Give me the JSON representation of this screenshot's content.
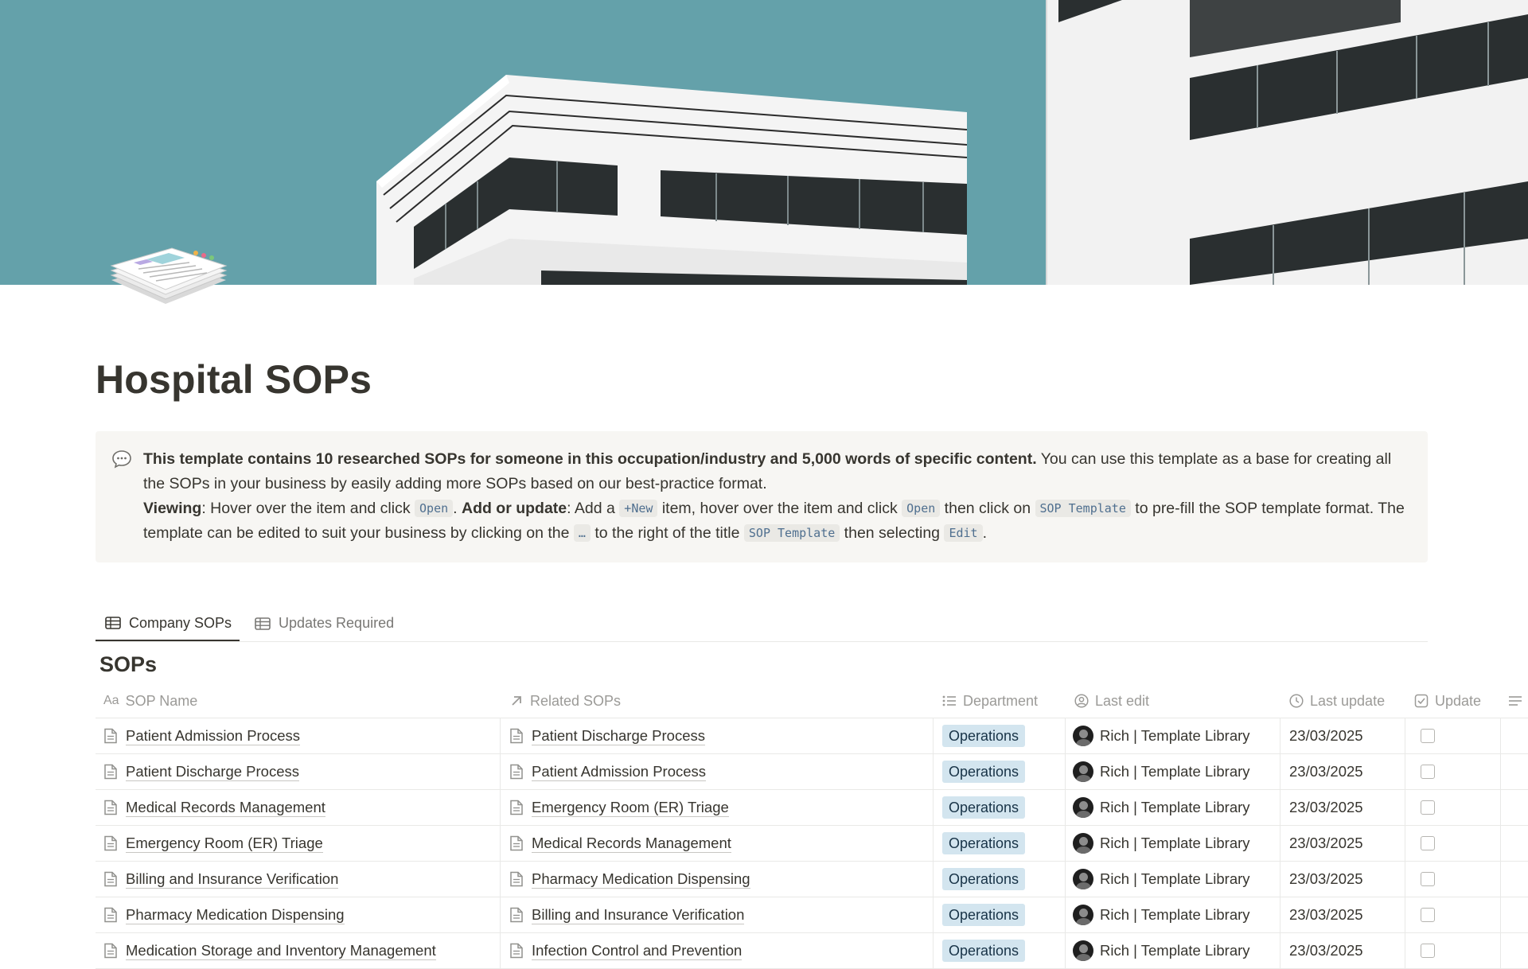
{
  "page": {
    "title": "Hospital SOPs",
    "icon": "stacked-papers-icon"
  },
  "callout": {
    "icon": "speech-bubble-icon",
    "bold_intro": "This template contains 10 researched SOPs for someone in this occupation/industry and 5,000 words of specific content.",
    "intro_rest": " You can use this template as a base for creating all the SOPs in your business by easily adding more SOPs based on our best-practice format.",
    "viewing_label": "Viewing",
    "viewing_text_1": ": Hover over the item and click ",
    "code_open": "Open",
    "viewing_text_2": ". ",
    "add_label": "Add or update",
    "add_text_1": ": Add a ",
    "code_new": "+New",
    "add_text_2": " item, hover over the item and click ",
    "code_open_2": "Open",
    "add_text_3": " then click on ",
    "code_sop_template": "SOP Template",
    "add_text_4": " to pre-fill the SOP template format. The template can be edited to suit your business by clicking on the ",
    "code_dots": "…",
    "add_text_5": " to the right of the title ",
    "code_sop_template_2": "SOP Template",
    "add_text_6": " then selecting ",
    "code_edit": "Edit",
    "add_text_7": "."
  },
  "tabs": [
    {
      "label": "Company SOPs",
      "icon": "table-icon",
      "active": true
    },
    {
      "label": "Updates Required",
      "icon": "table-icon",
      "active": false
    }
  ],
  "database": {
    "title": "SOPs",
    "columns": [
      {
        "label": "SOP Name",
        "icon": "text-property-icon"
      },
      {
        "label": "Related SOPs",
        "icon": "relation-arrow-icon"
      },
      {
        "label": "Department",
        "icon": "list-select-icon"
      },
      {
        "label": "Last edit",
        "icon": "person-icon"
      },
      {
        "label": "Last update",
        "icon": "clock-icon"
      },
      {
        "label": "Update",
        "icon": "checkbox-property-icon"
      }
    ],
    "rows": [
      {
        "name": "Patient Admission Process",
        "related": "Patient Discharge Process",
        "department": "Operations",
        "editor": "Rich | Template Library",
        "date": "23/03/2025",
        "update": false
      },
      {
        "name": "Patient Discharge Process",
        "related": "Patient Admission Process",
        "department": "Operations",
        "editor": "Rich | Template Library",
        "date": "23/03/2025",
        "update": false
      },
      {
        "name": "Medical Records Management",
        "related": "Emergency Room (ER) Triage",
        "department": "Operations",
        "editor": "Rich | Template Library",
        "date": "23/03/2025",
        "update": false
      },
      {
        "name": "Emergency Room (ER) Triage",
        "related": "Medical Records Management",
        "department": "Operations",
        "editor": "Rich | Template Library",
        "date": "23/03/2025",
        "update": false
      },
      {
        "name": "Billing and Insurance Verification",
        "related": "Pharmacy Medication Dispensing",
        "department": "Operations",
        "editor": "Rich | Template Library",
        "date": "23/03/2025",
        "update": false
      },
      {
        "name": "Pharmacy Medication Dispensing",
        "related": "Billing and Insurance Verification",
        "department": "Operations",
        "editor": "Rich | Template Library",
        "date": "23/03/2025",
        "update": false
      },
      {
        "name": "Medication Storage and Inventory Management",
        "related": "Infection Control and Prevention",
        "department": "Operations",
        "editor": "Rich | Template Library",
        "date": "23/03/2025",
        "update": false
      }
    ]
  },
  "colors": {
    "cover_sky": "#64a1aa",
    "department_tag_bg": "#d3e5ef",
    "text": "#37352f",
    "muted": "#9b9a97"
  }
}
